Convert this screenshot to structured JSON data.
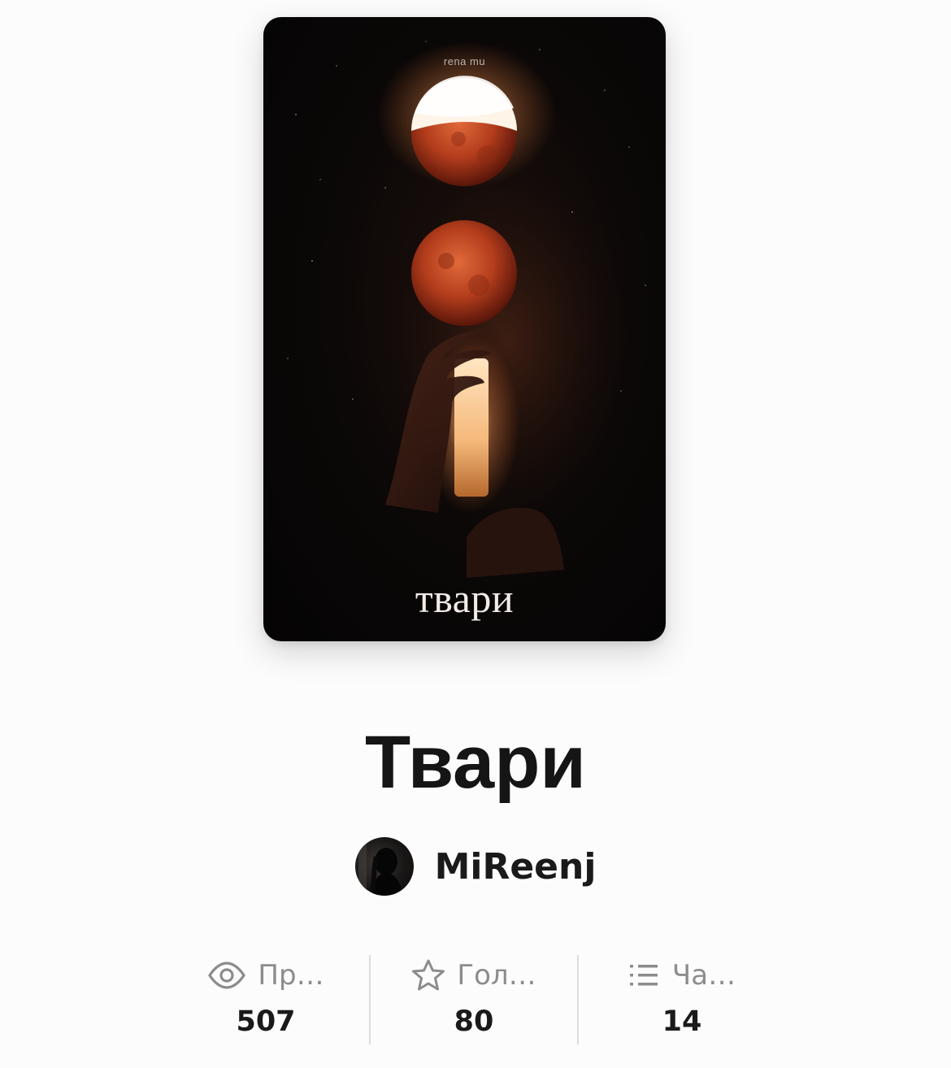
{
  "book": {
    "cover": {
      "author_text": "rena mu",
      "title_text": "твари"
    },
    "title": "Твари",
    "author": {
      "name": "MiReenj"
    }
  },
  "stats": [
    {
      "icon": "eye-icon",
      "label": "Пр…",
      "value": "507"
    },
    {
      "icon": "star-icon",
      "label": "Гол…",
      "value": "80"
    },
    {
      "icon": "list-icon",
      "label": "Ча…",
      "value": "14"
    }
  ]
}
